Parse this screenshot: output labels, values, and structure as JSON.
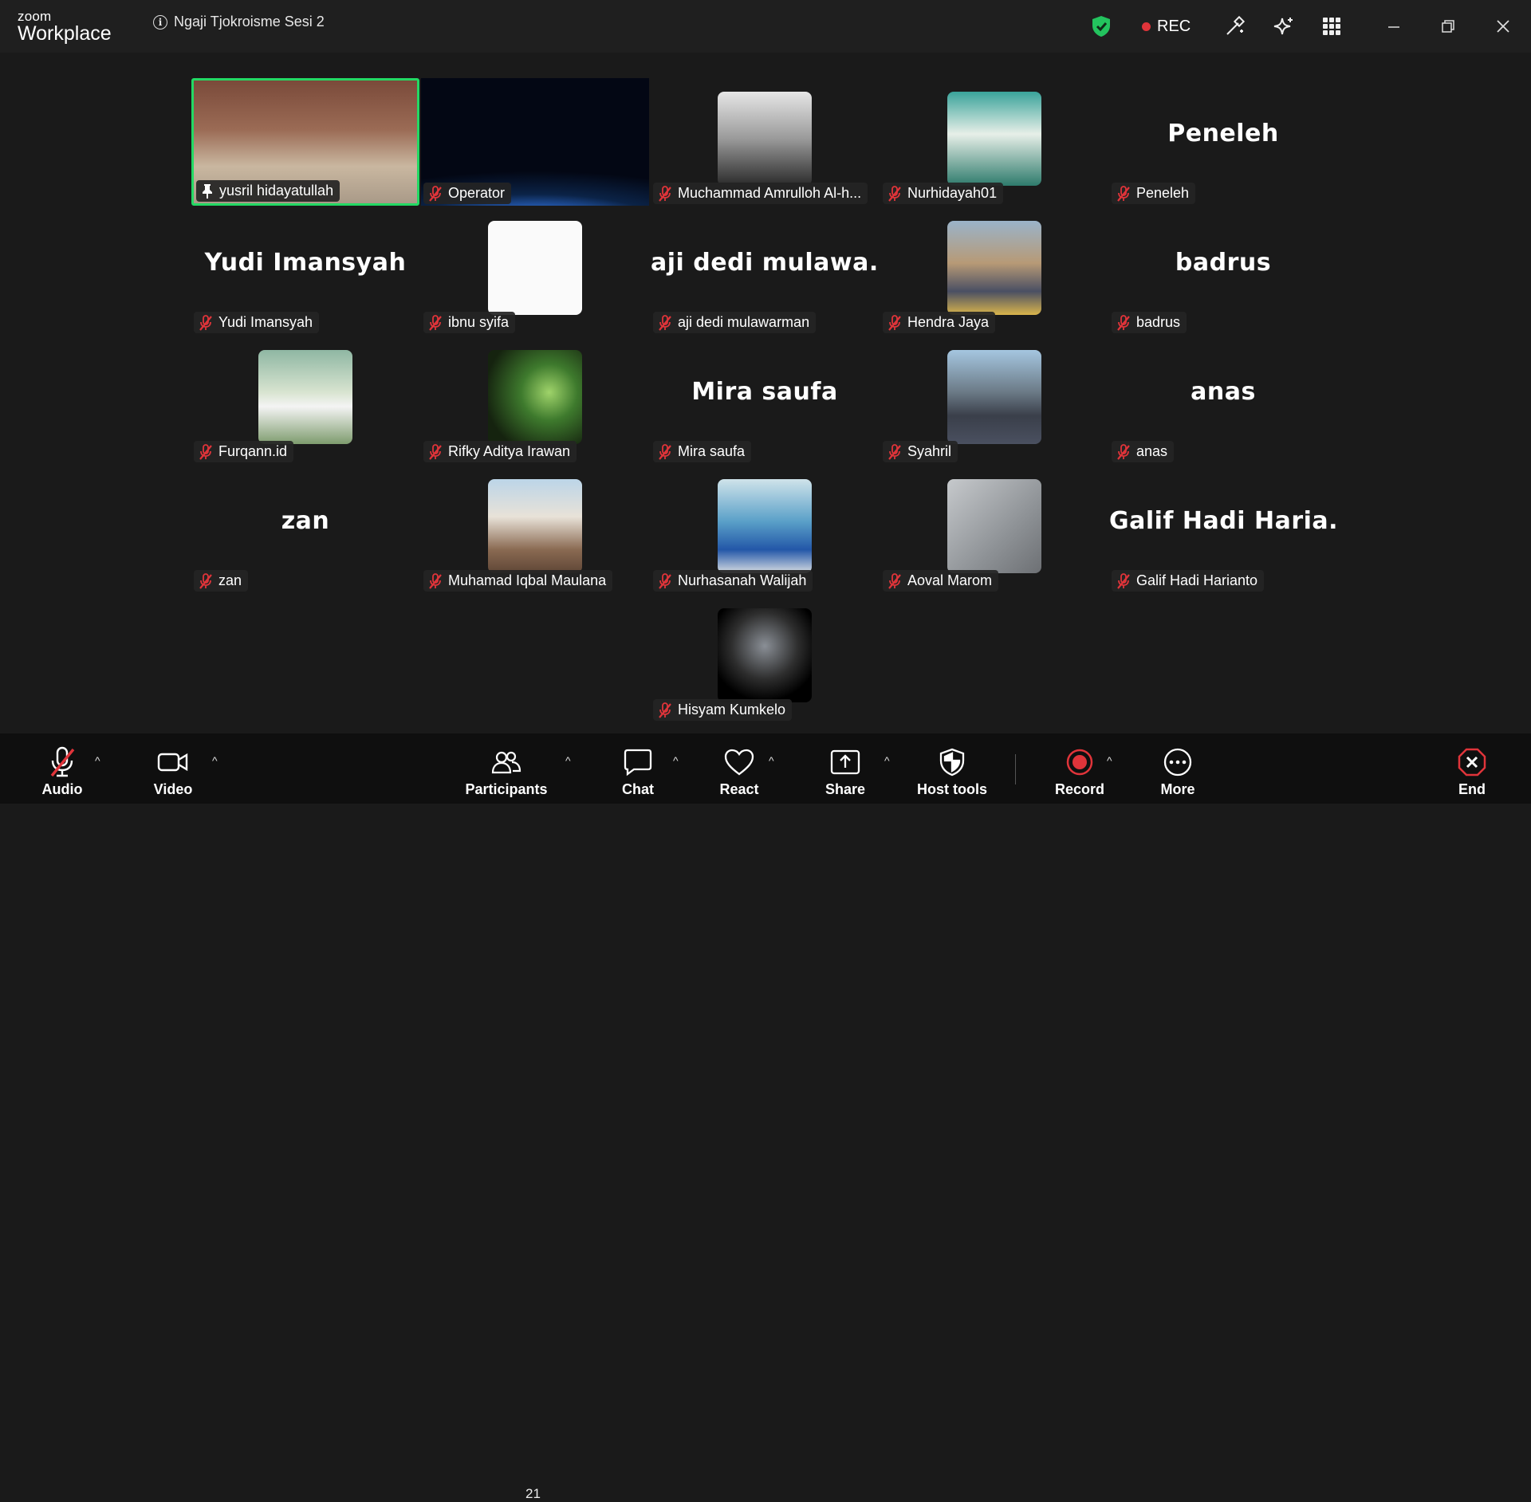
{
  "app": {
    "logo_top": "zoom",
    "logo_bottom": "Workplace"
  },
  "meeting": {
    "title": "Ngaji Tjokroisme Sesi 2",
    "rec_label": "REC"
  },
  "colors": {
    "active_speaker": "#23d964",
    "rec_red": "#e0343a",
    "muted_red": "#e0343a",
    "end_red": "#e0343a"
  },
  "participants": [
    {
      "name": "yusril hidayatullah",
      "tag": "yusril hidayatullah",
      "mode": "video",
      "active": true,
      "icon": "pin-icon"
    },
    {
      "name": "Operator",
      "tag": "Operator",
      "mode": "video"
    },
    {
      "name": "Muchammad Amrulloh Al-h...",
      "tag": "Muchammad Amrulloh Al-h...",
      "mode": "avatar"
    },
    {
      "name": "Nurhidayah01",
      "tag": "Nurhidayah01",
      "mode": "avatar"
    },
    {
      "name": "Peneleh",
      "tag": "Peneleh",
      "mode": "text",
      "big": "Peneleh"
    },
    {
      "name": "Yudi Imansyah",
      "tag": "Yudi Imansyah",
      "mode": "text",
      "big": "Yudi Imansyah"
    },
    {
      "name": "ibnu syifa",
      "tag": "ibnu syifa",
      "mode": "avatar"
    },
    {
      "name": "aji dedi mulawarman",
      "tag": "aji dedi mulawarman",
      "mode": "text",
      "big": "aji dedi mulawa..."
    },
    {
      "name": "Hendra Jaya",
      "tag": "Hendra Jaya",
      "mode": "avatar"
    },
    {
      "name": "badrus",
      "tag": "badrus",
      "mode": "text",
      "big": "badrus"
    },
    {
      "name": "Furqann.id",
      "tag": "Furqann.id",
      "mode": "avatar"
    },
    {
      "name": "Rifky Aditya Irawan",
      "tag": "Rifky Aditya Irawan",
      "mode": "avatar"
    },
    {
      "name": "Mira saufa",
      "tag": "Mira saufa",
      "mode": "text",
      "big": "Mira saufa"
    },
    {
      "name": "Syahril",
      "tag": "Syahril",
      "mode": "avatar"
    },
    {
      "name": "anas",
      "tag": "anas",
      "mode": "text",
      "big": "anas"
    },
    {
      "name": "zan",
      "tag": "zan",
      "mode": "text",
      "big": "zan"
    },
    {
      "name": "Muhamad Iqbal Maulana",
      "tag": "Muhamad Iqbal Maulana",
      "mode": "avatar"
    },
    {
      "name": "Nurhasanah Walijah",
      "tag": "Nurhasanah Walijah",
      "mode": "avatar"
    },
    {
      "name": "Aoval Marom",
      "tag": "Aoval Marom",
      "mode": "avatar"
    },
    {
      "name": "Galif Hadi Harianto",
      "tag": "Galif Hadi Harianto",
      "mode": "text",
      "big": "Galif Hadi Haria..."
    },
    {
      "name": "Hisyam Kumkelo",
      "tag": "Hisyam Kumkelo",
      "mode": "avatar"
    }
  ],
  "toolbar": {
    "audio": "Audio",
    "video": "Video",
    "participants": "Participants",
    "participants_count": "21",
    "chat": "Chat",
    "react": "React",
    "share": "Share",
    "host_tools": "Host tools",
    "record": "Record",
    "more": "More",
    "end": "End"
  }
}
